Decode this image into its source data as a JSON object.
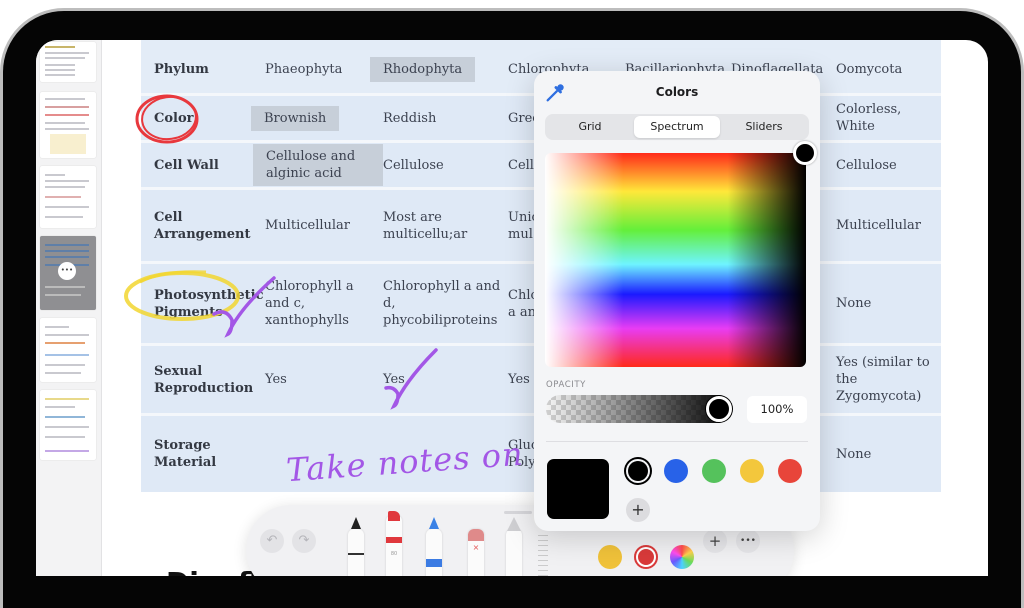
{
  "sidebar": {
    "thumbnails": [
      {
        "label": "page-1"
      },
      {
        "label": "page-2"
      },
      {
        "label": "page-3"
      },
      {
        "label": "page-4",
        "selected": true,
        "more_label": "•••"
      },
      {
        "label": "page-5"
      },
      {
        "label": "page-6"
      }
    ]
  },
  "table": {
    "header": {
      "label": "Phylum",
      "values": [
        "Phaeophyta",
        "Rhodophyta",
        "Chlorophyta",
        "Bacillariophyta",
        "Dinoflagellata",
        "Oomycota"
      ]
    },
    "rows": [
      {
        "label": "Color",
        "values": [
          "Brownish",
          "Reddish",
          "Gree",
          "",
          "",
          "Colorless, White"
        ]
      },
      {
        "label": "Cell Wall",
        "values": [
          "Cellulose and alginic acid",
          "Cellulose",
          "Cellu",
          "",
          "",
          "Cellulose"
        ]
      },
      {
        "label": "Cell Arrangement",
        "values": [
          "Multicellular",
          "Most are multicellu;ar",
          "Unic mul",
          "",
          "",
          "Multicellular"
        ]
      },
      {
        "label": "Photosynthetic Pigments",
        "values": [
          "Chlorophyll a and c, xanthophylls",
          "Chlorophyll a and d, phycobiliproteins",
          "Chlo a an",
          "",
          "",
          "None"
        ]
      },
      {
        "label": "Sexual Reproduction",
        "values": [
          "Yes",
          "Yes",
          "Yes",
          "",
          "",
          "Yes (similar to the Zygomycota)"
        ]
      },
      {
        "label": "Storage Material",
        "values": [
          "",
          "",
          "Gluc Poly",
          "",
          "",
          "None"
        ]
      }
    ]
  },
  "below_heading": "Dinofl",
  "handwriting": "Take notes on iPad",
  "annotation_colors": {
    "circle": "#e8383d",
    "highlight": "#f2d630",
    "check": "#a357e6"
  },
  "color_picker": {
    "title": "Colors",
    "eyedropper_icon": "eyedropper-icon",
    "tabs": [
      {
        "label": "Grid",
        "active": false
      },
      {
        "label": "Spectrum",
        "active": true
      },
      {
        "label": "Sliders",
        "active": false
      }
    ],
    "opacity_label": "OPACITY",
    "opacity_percent": 100,
    "opacity_value": "100%",
    "current_color": "#000000",
    "swatches": [
      {
        "name": "black",
        "color": "#000000",
        "selected": true
      },
      {
        "name": "blue",
        "color": "#2862e8"
      },
      {
        "name": "green",
        "color": "#55c25c"
      },
      {
        "name": "yellow",
        "color": "#f3c73c"
      },
      {
        "name": "red",
        "color": "#e8453a"
      }
    ],
    "add_label": "+"
  },
  "tool_palette": {
    "undo_icon": "↶",
    "redo_icon": "↷",
    "tools": [
      "pen",
      "marker",
      "pencil-blue",
      "eraser",
      "pencil-lasso"
    ],
    "marker_label": "80",
    "colors": [
      {
        "name": "black",
        "color": "#000000"
      },
      {
        "name": "blue",
        "color": "#2e6be0"
      },
      {
        "name": "yellow",
        "color": "#f0c23a"
      },
      {
        "name": "red",
        "color": "#d93a3a",
        "selected": true
      },
      {
        "name": "multicolor",
        "color": "conic"
      }
    ],
    "add_label": "+",
    "more_label": "•••"
  }
}
